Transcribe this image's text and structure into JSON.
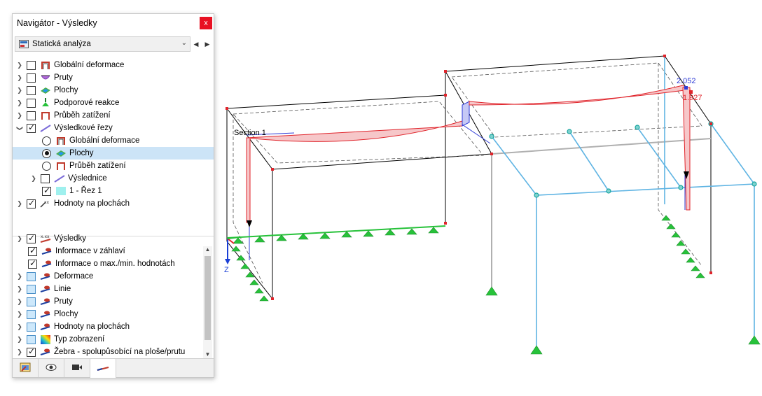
{
  "navigator": {
    "title": "Navigátor - Výsledky",
    "close_glyph": "x",
    "analysis_combo": {
      "value": "Statická analýza"
    },
    "prev_glyph": "◀",
    "next_glyph": "▶",
    "results_tree": [
      {
        "label": "Globální deformace",
        "icon": "global-deformation-icon",
        "checked": false
      },
      {
        "label": "Pruty",
        "icon": "members-icon",
        "checked": false
      },
      {
        "label": "Plochy",
        "icon": "surfaces-icon",
        "checked": false
      },
      {
        "label": "Podporové reakce",
        "icon": "support-reactions-icon",
        "checked": false
      },
      {
        "label": "Průběh zatížení",
        "icon": "load-distribution-icon",
        "checked": false
      },
      {
        "label": "Výsledkové řezy",
        "icon": "result-sections-icon",
        "checked": true
      },
      {
        "label": "Globální deformace",
        "icon": "global-deformation-icon",
        "radio": false
      },
      {
        "label": "Plochy",
        "icon": "surfaces-icon",
        "radio": true
      },
      {
        "label": "Průběh zatížení",
        "icon": "load-distribution-icon",
        "radio": false
      },
      {
        "label": "Výslednice",
        "icon": "resultants-icon",
        "checked": false
      },
      {
        "label": "1 - Řez 1",
        "icon": "section-swatch-icon",
        "checked": true
      },
      {
        "label": "Hodnoty na plochách",
        "icon": "surface-values-icon",
        "checked": true
      }
    ],
    "display_tree": [
      {
        "label": "Výsledky",
        "icon": "results-values-icon",
        "checked": true
      },
      {
        "label": "Informace v záhlaví",
        "icon": "info-header-icon",
        "checked": true
      },
      {
        "label": "Informace o max./min. hodnotách",
        "icon": "max-min-info-icon",
        "checked": true
      },
      {
        "label": "Deformace",
        "icon": "deformation-display-icon",
        "checked": false
      },
      {
        "label": "Linie",
        "icon": "lines-display-icon",
        "checked": false
      },
      {
        "label": "Pruty",
        "icon": "members-display-icon",
        "checked": false
      },
      {
        "label": "Plochy",
        "icon": "surfaces-display-icon",
        "checked": false
      },
      {
        "label": "Hodnoty na plochách",
        "icon": "surface-values-display-icon",
        "checked": false
      },
      {
        "label": "Typ zobrazení",
        "icon": "display-type-icon",
        "checked": false
      },
      {
        "label": "Žebra - spolupůsobící na ploše/prutu",
        "icon": "ribs-icon",
        "checked": true
      }
    ],
    "tabs": [
      {
        "name": "data-tab",
        "icon": "data-navigator-icon"
      },
      {
        "name": "display-tab",
        "icon": "eye-icon"
      },
      {
        "name": "views-tab",
        "icon": "camera-icon"
      },
      {
        "name": "results-tab",
        "icon": "results-navigator-icon",
        "active": true
      }
    ]
  },
  "viewport": {
    "section_label": "Section 1",
    "max_value": "2.052",
    "min_value": "1.927",
    "axis_z_label": "Z",
    "colors": {
      "frame": "#000000",
      "member_blue": "#5fb4e3",
      "member_gray": "#b0b0b0",
      "diagram_red": "#e0242b",
      "diagram_blue": "#2e3bd6",
      "support_green": "#27c23a",
      "node_teal": "#1aa6a0"
    }
  }
}
